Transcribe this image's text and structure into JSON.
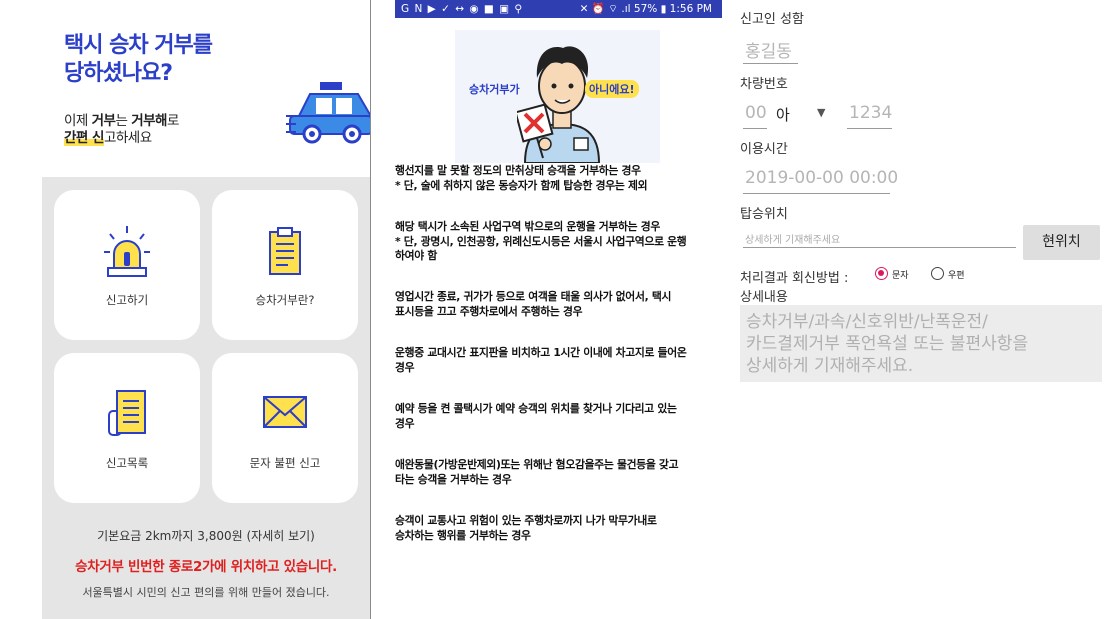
{
  "home": {
    "title_line1": "택시 승차 거부를",
    "title_line2": "당하셨나요?",
    "subtitle_pre": "이제 ",
    "subtitle_b1": "거부",
    "subtitle_mid": "는 ",
    "subtitle_b2": "거부해",
    "subtitle_post": "로",
    "subtitle_hl1": "간편 신",
    "subtitle_post2": "고하세요",
    "cards": [
      {
        "label": "신고하기"
      },
      {
        "label": "승차거부란?"
      },
      {
        "label": "신고목록"
      },
      {
        "label": "문자 불편 신고"
      }
    ],
    "fee": "기본요금 2km까지 3,800원 (자세히 보기)",
    "alert": "승차거부 빈번한 종로2가에 위치하고 있습니다.",
    "made_by": "서울특별시 시민의 신고 편의를 위해 만들어 졌습니다.",
    "colors": {
      "brand": "#2b3fc9",
      "accent": "#ffe04d",
      "alert": "#e01f1f"
    }
  },
  "info": {
    "status_icons": "G N ▶ ✓ ↔ ◉ ■ ▣ ⚲",
    "status_right": "✕ ⏰ ⌔ .ıl 57% ▮ 1:56 PM",
    "banner_left": "승차거부가",
    "banner_right": "아니에요!",
    "cases": [
      {
        "l1": "행선지를 말 못할 정도의 만취상태 승객을 거부하는 경우",
        "l2": "* 단, 술에 취하지 않은 동승자가 함께 탑승한 경우는 제외",
        "l3": ""
      },
      {
        "l1": "해당 택시가 소속된 사업구역 밖으로의 운행을 거부하는 경우",
        "l2": "* 단, 광명시, 인천공항, 위례신도시등은 서울시 사업구역으로 운행",
        "l3": "하여야 함"
      },
      {
        "l1": "영업시간 종료, 귀가가 등으로 여객을 태울 의사가 없어서, 택시",
        "l2": "표시등을 끄고 주행차로에서 주행하는 경우",
        "l3": ""
      },
      {
        "l1": "운행중 교대시간 표지판을 비치하고 1시간 이내에 차고지로 들어온",
        "l2": "경우",
        "l3": ""
      },
      {
        "l1": "예약 등을 켠 콜택시가 예약 승객의 위치를 찾거나 기다리고 있는",
        "l2": "경우",
        "l3": ""
      },
      {
        "l1": "애완동물(가방운반제외)또는 위해난 혐오감을주는 물건등을 갖고",
        "l2": "타는 승객을 거부하는 경우",
        "l3": ""
      },
      {
        "l1": "승객이 교통사고 위험이 있는 주행차로까지 나가 막무가내로",
        "l2": "승차하는 행위를 거부하는 경우",
        "l3": ""
      }
    ]
  },
  "form": {
    "name_label": "신고인 성함",
    "name_placeholder": "홍길동",
    "plate_label": "차량번호",
    "plate_prefix": "00",
    "plate_letter": "아",
    "plate_number": "1234",
    "time_label": "이용시간",
    "time_placeholder": "2019-00-00 00:00",
    "location_label": "탑승위치",
    "location_placeholder": "상세하게 기재해주세요",
    "current_location_button": "현위치",
    "reply_label": "처리결과 회신방법 :",
    "reply_options": [
      "문자",
      "우편"
    ],
    "reply_selected": "문자",
    "detail_label": "상세내용",
    "detail_placeholder_l1": "승차거부/과속/신호위반/난폭운전/",
    "detail_placeholder_l2": "카드결제거부 폭언욕설 또는 불편사항을",
    "detail_placeholder_l3": "상세하게 기재해주세요.",
    "radio_color": "#d81b60"
  }
}
